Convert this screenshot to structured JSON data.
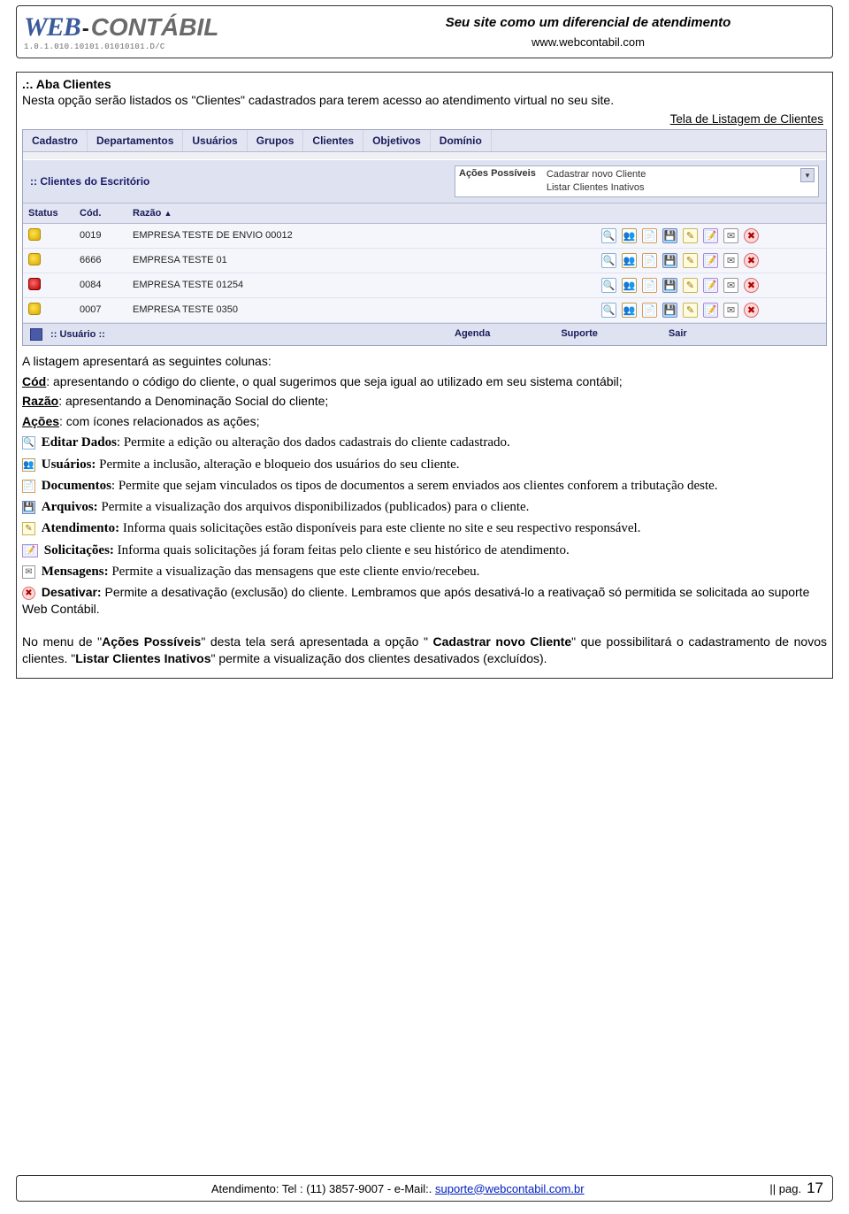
{
  "header": {
    "logo_web": "WEB",
    "logo_dash": "-",
    "logo_contabil": "CONTÁBIL",
    "logo_sub": "1.0.1.010.10101.01010101.D/C",
    "tagline": "Seu site como um diferencial de atendimento",
    "site_url": "www.webcontabil.com"
  },
  "section": {
    "title": ".:. Aba Clientes",
    "intro": "Nesta opção serão listados os \"Clientes\" cadastrados para terem acesso ao atendimento virtual no seu site.",
    "caption": "Tela de Listagem de Clientes"
  },
  "app": {
    "menubar": [
      "Cadastro",
      "Departamentos",
      "Usuários",
      "Grupos",
      "Clientes",
      "Objetivos",
      "Domínio"
    ],
    "panel_title": ":: Clientes do Escritório",
    "actions_label": "Ações Possíveis",
    "actions_list": [
      "Cadastrar novo Cliente",
      "Listar Clientes Inativos"
    ],
    "columns": {
      "status": "Status",
      "cod": "Cód.",
      "razao": "Razão"
    },
    "rows": [
      {
        "status": "y",
        "cod": "0019",
        "razao": "EMPRESA TESTE DE ENVIO 00012"
      },
      {
        "status": "y",
        "cod": "6666",
        "razao": "EMPRESA TESTE 01"
      },
      {
        "status": "r",
        "cod": "0084",
        "razao": "EMPRESA TESTE 01254"
      },
      {
        "status": "y",
        "cod": "0007",
        "razao": "EMPRESA TESTE 0350"
      }
    ],
    "statusbar": {
      "user": " :: Usuário ::",
      "items": [
        "Agenda",
        "Suporte",
        "Sair"
      ]
    }
  },
  "body": {
    "line1": "A listagem apresentará as seguintes colunas:",
    "cod_lbl": "Cód",
    "cod_txt": ": apresentando o código do cliente, o qual sugerimos que seja igual ao utilizado em seu sistema contábil;",
    "razao_lbl": "Razão",
    "razao_txt": ": apresentando a Denominação Social do cliente;",
    "acoes_lbl": "Ações",
    "acoes_txt": ": com ícones relacionados as ações;",
    "editar_b": "Editar Dados",
    "editar_txt": ": Permite a edição ou alteração dos dados cadastrais do cliente cadastrado.",
    "usuarios_b": "Usuários:",
    "usuarios_txt": " Permite a inclusão, alteração e bloqueio dos usuários do seu cliente.",
    "doc_b": "Documentos",
    "doc_txt": ": Permite que sejam vinculados os tipos de documentos a serem enviados aos clientes conforem a tributação deste.",
    "arq_b": "Arquivos:",
    "arq_txt": " Permite a visualização dos arquivos disponibilizados (publicados) para o cliente.",
    "atend_b": "Atendimento:",
    "atend_txt": " Informa quais solicitações estão disponíveis para este cliente no site e seu respectivo responsável.",
    "solic_b": "Solicitações:",
    "solic_txt": "  Informa quais solicitações já foram feitas pelo cliente e seu histórico de atendimento.",
    "msg_b": "Mensagens:",
    "msg_txt": " Permite a visualização das mensagens que este cliente envio/recebeu.",
    "desativ_b": "Desativar:",
    "desativ_txt": " Permite a desativação (exclusão) do cliente. Lembramos que após desativá-lo a reativaçaõ só permitida se solicitada ao suporte Web Contábil.",
    "final1a": "No menu de \"",
    "final1b": "Ações Possíveis",
    "final1c": "\" desta tela será apresentada a opção \" ",
    "final1d": "Cadastrar novo Cliente",
    "final1e": "\" que possibilitará o cadastramento de novos clientes. \"",
    "final1f": "Listar Clientes Inativos",
    "final1g": "\" permite a visualização dos clientes desativados (excluídos)."
  },
  "footer": {
    "prefix": "Atendimento:  Tel : (11) 3857-9007 - e-Mail:. ",
    "mail": "suporte@webcontabil.com.br",
    "pag_label": "|| pag.",
    "pag_num": "17"
  }
}
